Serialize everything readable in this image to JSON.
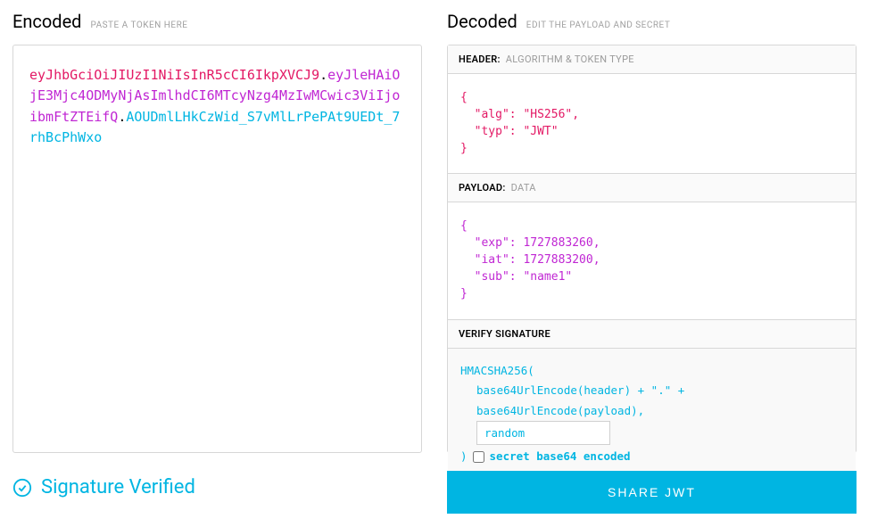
{
  "encoded": {
    "title": "Encoded",
    "subtitle": "PASTE A TOKEN HERE",
    "token_header": "eyJhbGciOiJIUzI1NiIsInR5cCI6IkpXVCJ9",
    "dot": ".",
    "token_payload": "eyJleHAiOjE3Mjc4ODMyNjAsImlhdCI6MTcyNzg4MzIwMCwic3ViIjoibmFtZTEifQ",
    "token_sig": "AOUDmlLHkCzWid_S7vMlLrPePAt9UEDt_7rhBcPhWxo"
  },
  "decoded": {
    "title": "Decoded",
    "subtitle": "EDIT THE PAYLOAD AND SECRET",
    "header_section": {
      "label_bold": "HEADER:",
      "label_muted": "ALGORITHM & TOKEN TYPE",
      "content": "{\n  \"alg\": \"HS256\",\n  \"typ\": \"JWT\"\n}"
    },
    "payload_section": {
      "label_bold": "PAYLOAD:",
      "label_muted": "DATA",
      "content": "{\n  \"exp\": 1727883260,\n  \"iat\": 1727883200,\n  \"sub\": \"name1\"\n}"
    },
    "signature_section": {
      "label_bold": "VERIFY SIGNATURE",
      "line1": "HMACSHA256(",
      "line2": "base64UrlEncode(header) + \".\" +",
      "line3": "base64UrlEncode(payload),",
      "secret_value": "random",
      "closing_paren": ")",
      "checkbox_label": "secret base64 encoded"
    }
  },
  "footer": {
    "verified_text": "Signature Verified",
    "share_label": "SHARE JWT"
  }
}
